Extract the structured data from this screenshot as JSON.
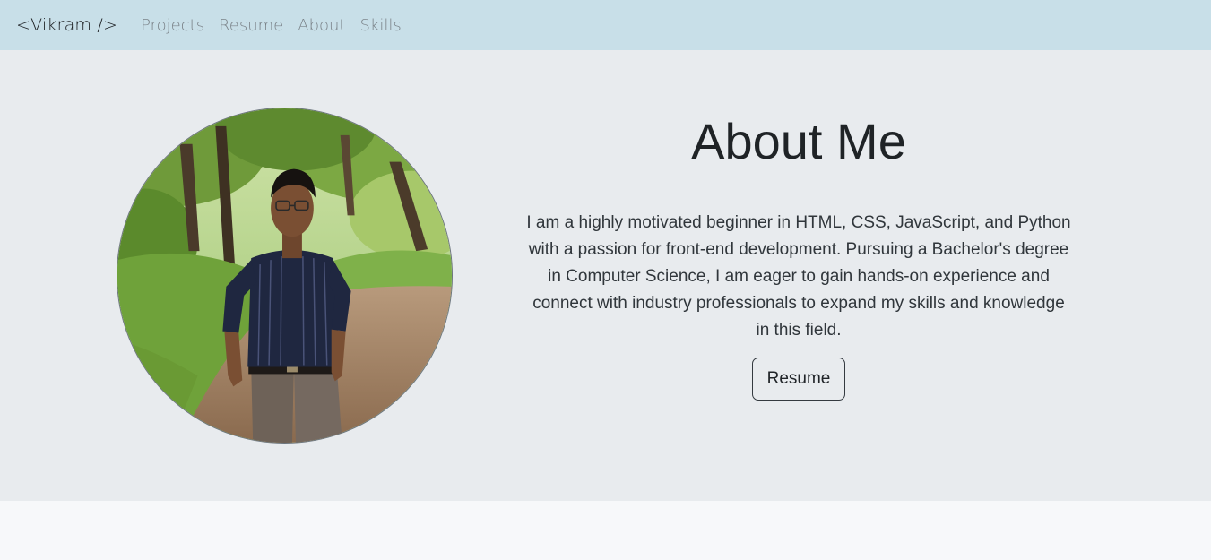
{
  "navbar": {
    "brand": "<Vikram />",
    "links": [
      "Projects",
      "Resume",
      "About",
      "Skills"
    ]
  },
  "about": {
    "title": "About Me",
    "text": "I am a highly motivated beginner in HTML, CSS, JavaScript, and Python with a passion for front-end development. Pursuing a Bachelor's degree in Computer Science, I am eager to gain hands-on experience and connect with industry professionals to expand my skills and knowledge in this field.",
    "button_label": "Resume"
  },
  "colors": {
    "navbar_bg": "#c8dfe8",
    "hero_bg": "#e8ebee",
    "page_bg": "#f7f8fa"
  }
}
